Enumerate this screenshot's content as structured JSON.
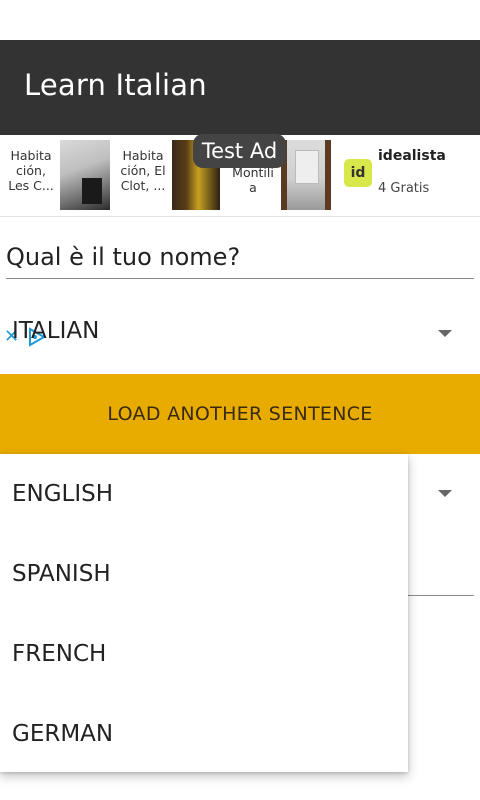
{
  "app": {
    "title": "Learn Italian"
  },
  "ad": {
    "badge": "Test Ad",
    "item1_text": "Habita ción, Les C...",
    "item2_text": "Habita ción, El Clot, ...",
    "item3_text": "Montili a",
    "brand": "idealista",
    "brand_logo": "id",
    "subtext": "4 Gratis",
    "close_icon": "close-icon",
    "adchoices_icon": "adchoices-icon"
  },
  "form": {
    "name_value": "Qual è il tuo nome?",
    "source_language": "ITALIAN",
    "load_button_label": "LOAD ANOTHER SENTENCE"
  },
  "dropdown": {
    "options": [
      "ENGLISH",
      "SPANISH",
      "FRENCH",
      "GERMAN"
    ]
  },
  "colors": {
    "app_bar": "#333333",
    "accent": "#e8ac00"
  }
}
